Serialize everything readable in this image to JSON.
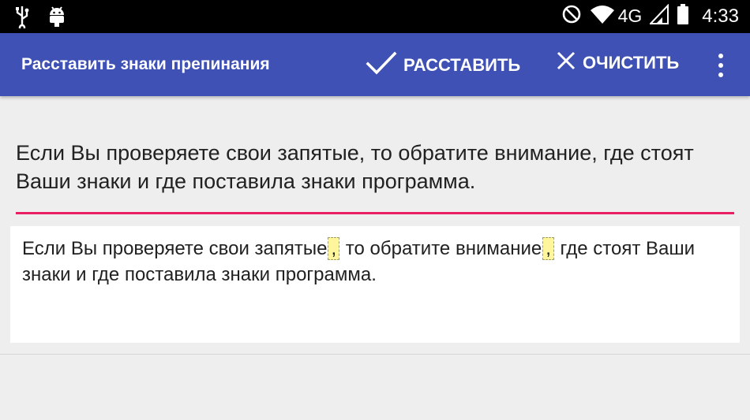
{
  "status_bar": {
    "left_icons": [
      "usb-icon",
      "android-debug-icon"
    ],
    "right_icons": [
      "do-not-disturb-icon",
      "wifi-icon",
      "signal-icon",
      "battery-icon"
    ],
    "network": "4G",
    "time": "4:33"
  },
  "app_bar": {
    "title": "Расставить знаки препинания",
    "apply_label": "РАССТАВИТЬ",
    "clear_label": "ОЧИСТИТЬ",
    "colors": {
      "primary": "#3f51b5",
      "accent": "#e91e63"
    }
  },
  "input": {
    "text": "Если Вы проверяете свои запятые, то обратите внимание, где стоят Ваши знаки и где поставила знаки программа."
  },
  "result": {
    "seg1": "Если Вы проверяете свои запятые",
    "mark1": ",",
    "seg2": " то обратите внимание",
    "mark2": ",",
    "seg3": " где стоят Ваши знаки и где поставила знаки программа."
  }
}
